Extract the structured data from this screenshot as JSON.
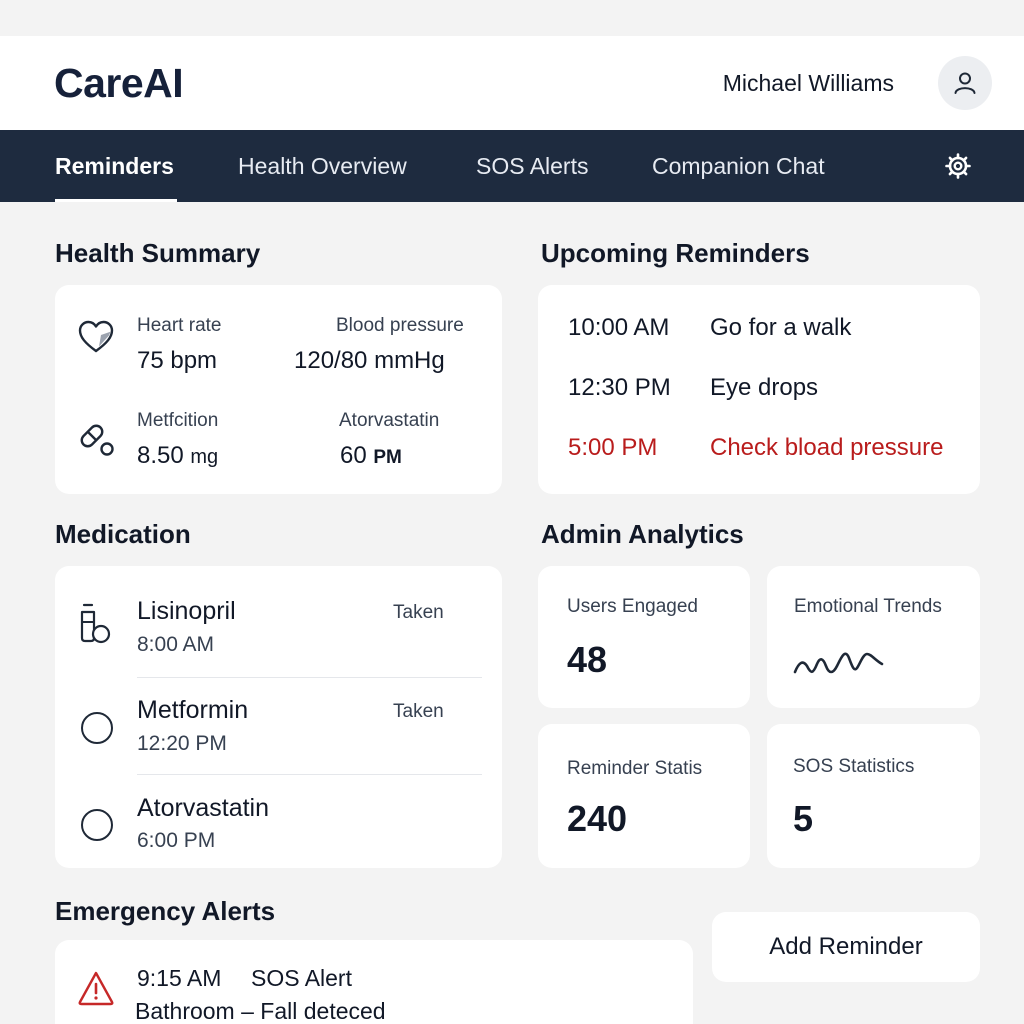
{
  "app": {
    "logo": "CareAI",
    "user_name": "Michael Williams"
  },
  "nav": {
    "tabs": [
      {
        "label": "Reminders",
        "active": true
      },
      {
        "label": "Health Overview",
        "active": false
      },
      {
        "label": "SOS Alerts",
        "active": false
      },
      {
        "label": "Companion Chat",
        "active": false
      }
    ]
  },
  "health_summary": {
    "title": "Health Summary",
    "heart_rate_label": "Heart rate",
    "heart_rate_value": "75 bpm",
    "blood_pressure_label": "Blood pressure",
    "blood_pressure_value": "120/80 mmHg",
    "med1_label": "Metfcition",
    "med1_value": "8.50",
    "med1_unit": "mg",
    "med2_label": "Atorvastatin",
    "med2_value": "60",
    "med2_unit": "PM"
  },
  "upcoming_reminders": {
    "title": "Upcoming Reminders",
    "items": [
      {
        "time": "10:00 AM",
        "text": "Go for a walk",
        "urgent": false
      },
      {
        "time": "12:30 PM",
        "text": "Eye drops",
        "urgent": false
      },
      {
        "time": "5:00 PM",
        "text": "Check bload pressure",
        "urgent": true
      }
    ]
  },
  "medication": {
    "title": "Medication",
    "items": [
      {
        "name": "Lisinopril",
        "time": "8:00 AM",
        "status": "Taken"
      },
      {
        "name": "Metformin",
        "time": "12:20 PM",
        "status": "Taken"
      },
      {
        "name": "Atorvastatin",
        "time": "6:00 PM",
        "status": ""
      }
    ]
  },
  "admin_analytics": {
    "title": "Admin Analytics",
    "users_engaged_label": "Users Engaged",
    "users_engaged_value": "48",
    "emotional_trends_label": "Emotional Trends",
    "reminder_stats_label": "Reminder Statis",
    "reminder_stats_value": "240",
    "sos_stats_label": "SOS Statistics",
    "sos_stats_value": "5"
  },
  "emergency_alerts": {
    "title": "Emergency Alerts",
    "items": [
      {
        "time": "9:15 AM",
        "type": "SOS Alert",
        "detail": "Bathroom – Fall deteced"
      }
    ]
  },
  "actions": {
    "add_reminder_label": "Add Reminder"
  },
  "colors": {
    "nav_bg": "#1e2b3f",
    "urgent": "#b91c1c",
    "alert_icon": "#c62828",
    "page_bg": "#f3f3f3"
  },
  "icons": [
    "user-icon",
    "gear-icon",
    "heart-icon",
    "pill-icon",
    "medicine-bottle-icon",
    "warning-triangle-icon"
  ]
}
